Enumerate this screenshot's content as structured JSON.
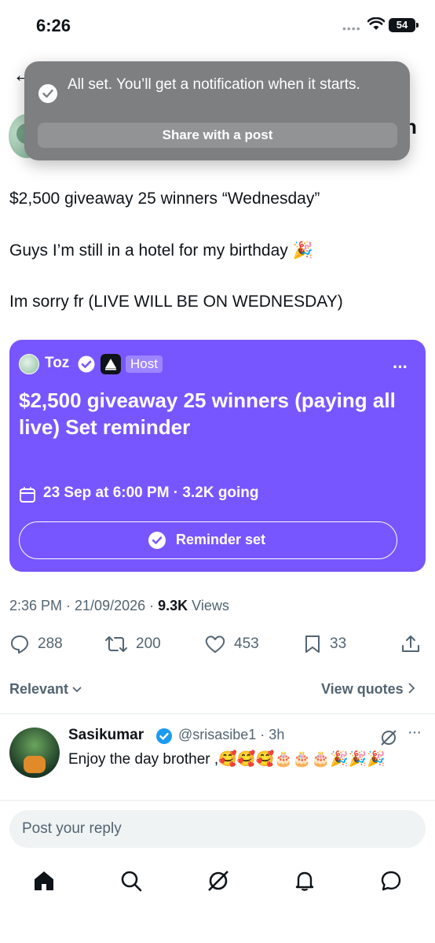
{
  "status_bar": {
    "time": "6:26",
    "battery": "54"
  },
  "toast": {
    "message": "All set. You’ll get a notification when it starts.",
    "share_label": "Share with a post"
  },
  "post": {
    "name_tail": "n",
    "line1": "$2,500 giveaway 25 winners “Wednesday”",
    "line2": "Guys I’m still in a hotel for my birthday 🎉",
    "line3": "Im sorry fr (LIVE WILL BE ON WEDNESDAY)"
  },
  "space": {
    "host_name": "Toz",
    "host_badge": "Host",
    "more": "···",
    "title": "$2,500 giveaway 25 winners (paying all live) Set reminder",
    "meta": "23 Sep at 6:00 PM · 3.2K going",
    "reminder_label": "Reminder set",
    "color": "#7856ff"
  },
  "meta": {
    "time_date": "2:36 PM · 21/09/2026 · ",
    "views_count": "9.3K",
    "views_label": " Views"
  },
  "actions": {
    "replies": "288",
    "reposts": "200",
    "likes": "453",
    "bookmarks": "33"
  },
  "replies_header": {
    "sort": "Relevant",
    "view_quotes": "View quotes"
  },
  "reply": {
    "name": "Sasikumar",
    "handle": "@srisasibe1 · 3h",
    "more": "···",
    "text": "Enjoy the day brother ,🥰🥰🥰🎂🎂🎂🎉🎉🎉"
  },
  "composer": {
    "placeholder": "Post your reply"
  }
}
